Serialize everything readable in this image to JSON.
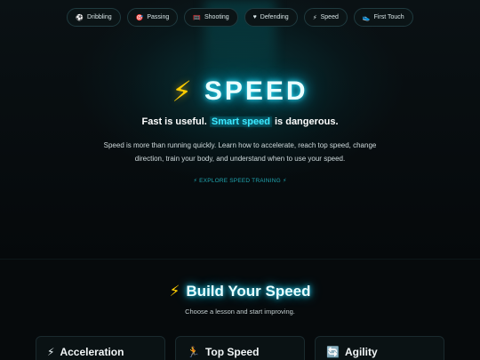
{
  "nav": {
    "items": [
      {
        "icon": "⚽",
        "label": "Dribbling"
      },
      {
        "icon": "🎯",
        "label": "Passing"
      },
      {
        "icon": "🥅",
        "label": "Shooting"
      },
      {
        "icon": "♥",
        "label": "Defending"
      },
      {
        "icon": "⚡",
        "label": "Speed"
      },
      {
        "icon": "👟",
        "label": "First Touch"
      }
    ]
  },
  "hero": {
    "bolt": "⚡",
    "title": "SPEED",
    "tagline_a": "Fast is useful. ",
    "tagline_highlight": "Smart speed",
    "tagline_b": " is dangerous.",
    "description": "Speed is more than running quickly. Learn how to accelerate, reach top speed, change direction, train your body, and understand when to use your speed.",
    "cta": "⚡ EXPLORE SPEED TRAINING ⚡"
  },
  "section": {
    "bolt": "⚡",
    "title": "Build Your Speed",
    "subtitle": "Choose a lesson and start improving."
  },
  "cards": [
    {
      "icon": "⚡",
      "label": "Acceleration"
    },
    {
      "icon": "🏃",
      "label": "Top Speed"
    },
    {
      "icon": "🔄",
      "label": "Agility"
    }
  ]
}
